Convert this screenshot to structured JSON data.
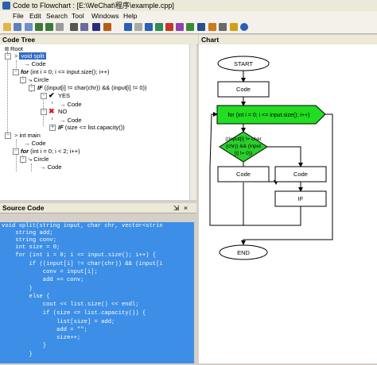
{
  "window": {
    "title": "Code to Flowchart : [E:\\WeChat\\程序\\example.cpp]"
  },
  "menu": [
    "File",
    "Edit",
    "Search",
    "Tool",
    "Windows",
    "Help"
  ],
  "panels": {
    "tree": "Code Tree",
    "source": "Source Code",
    "chart": "Chart"
  },
  "tree": {
    "root": "Root",
    "f1_name": "void split",
    "f1_code": "Code",
    "f1_for_kw": "for",
    "f1_for": "(int i = 0; i <= input.size(); i++)",
    "f1_circle": "Circle",
    "f1_if_kw": "IF",
    "f1_if": "((input[i] != char(chr)) && (input[i] != 0))",
    "f1_yes": "YES",
    "f1_yes_code": "Code",
    "f1_no": "NO",
    "f1_no_code": "Code",
    "f1_if2_kw": "IF",
    "f1_if2": "(size <= list.capacity())",
    "f2_name": "int main",
    "f2_code": "Code",
    "f2_for_kw": "for",
    "f2_for": "(int i = 0; i < 2; i++)",
    "f2_circle": "Circle",
    "f2_circle_code": "Code"
  },
  "source_lines": [
    "void split(string input, char chr, vector<strin",
    "    string add;",
    "    string conv;",
    "    int size = 0;",
    "    for (int i = 0; i <= input.size(); i++) {",
    "        if ((input[i] != char(chr)) && (input[i",
    "            conv = input[i];",
    "            add += conv;",
    "        }",
    "        else {",
    "            cout << list.size() << endl;",
    "            if (size <= list.capacity()) {",
    "                list[size] = add;",
    "                add = \"\";",
    "                size++;",
    "            }",
    "        }"
  ],
  "flowchart": {
    "start": "START",
    "code1": "Code",
    "for": "for (int i = 0; i <= input.size(); i++)",
    "if_l1": "((input[i] != char",
    "if_l2": "(chr)) && (input",
    "if_l3": "[i] != 0))",
    "code_left": "Code",
    "code_right": "Code",
    "if2": "IF",
    "end": "END"
  },
  "colors": {
    "selection": "#316ac5",
    "code_bg": "#3c8ee6",
    "for_green": "#22dd22",
    "if_green": "#2bcf2b"
  }
}
